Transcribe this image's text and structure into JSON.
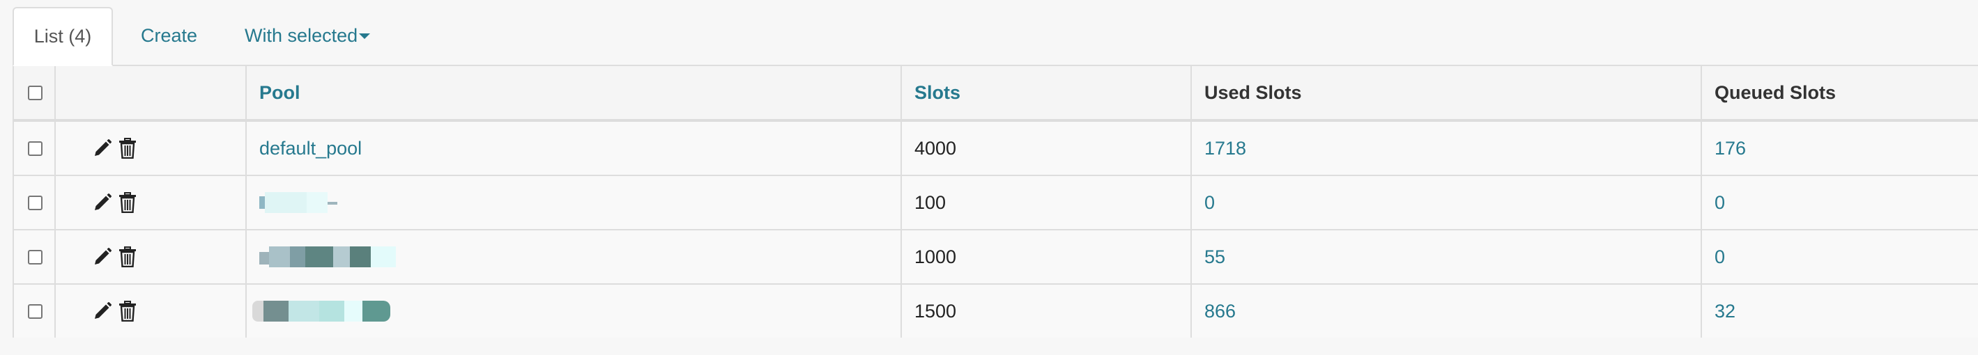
{
  "tabs": {
    "list_label": "List (4)",
    "create_label": "Create",
    "with_selected_label": "With selected"
  },
  "table": {
    "columns": {
      "pool": "Pool",
      "slots": "Slots",
      "used_slots": "Used Slots",
      "queued_slots": "Queued Slots"
    },
    "rows": [
      {
        "pool": "default_pool",
        "slots": "4000",
        "used_slots": "1718",
        "queued_slots": "176"
      },
      {
        "pool": "",
        "slots": "100",
        "used_slots": "0",
        "queued_slots": "0"
      },
      {
        "pool": "",
        "slots": "1000",
        "used_slots": "55",
        "queued_slots": "0"
      },
      {
        "pool": "",
        "slots": "1500",
        "used_slots": "866",
        "queued_slots": "32"
      }
    ]
  },
  "icons": {
    "edit": "pencil-icon",
    "delete": "trash-icon",
    "dropdown": "caret-down-icon"
  },
  "colors": {
    "link": "#26798e",
    "border": "#dddddd",
    "header_bg": "#f5f5f5",
    "row_bg": "#f9f9f9"
  }
}
